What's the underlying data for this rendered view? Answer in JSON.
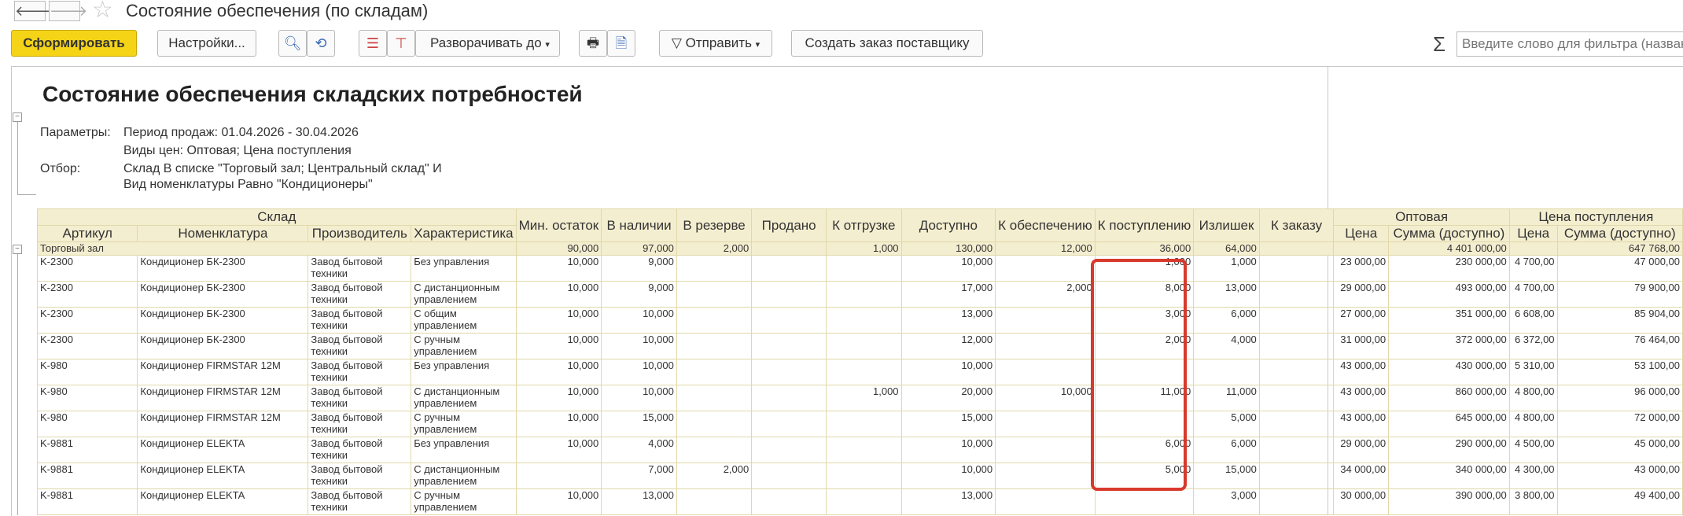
{
  "window": {
    "title": "Состояние обеспечения (по складам)"
  },
  "toolbar": {
    "generate": "Сформировать",
    "settings": "Настройки...",
    "expand": "Разворачивать до",
    "send": "Отправить",
    "create_order": "Создать заказ поставщику",
    "filter_placeholder": "Введите слово для фильтра (назван"
  },
  "report": {
    "title": "Состояние обеспечения складских потребностей",
    "params_label": "Параметры:",
    "params_line1": "Период продаж: 01.04.2026 - 30.04.2026",
    "params_line2": "Виды цен: Оптовая; Цена поступления",
    "filter_label": "Отбор:",
    "filter_line1": "Склад В списке \"Торговый зал; Центральный склад\" И",
    "filter_line2": "Вид номенклатуры Равно \"Кондиционеры\""
  },
  "headers": {
    "warehouse": "Склад",
    "article": "Артикул",
    "nomenclature": "Номенклатура",
    "manufacturer": "Производитель",
    "characteristic": "Характеристика",
    "min_stock": "Мин. остаток",
    "in_stock": "В наличии",
    "reserved": "В резерве",
    "sold": "Продано",
    "to_ship": "К отгрузке",
    "available": "Доступно",
    "to_provide": "К обеспечению",
    "to_receive": "К поступлению",
    "surplus": "Излишек",
    "to_order": "К заказу",
    "wholesale": "Оптовая",
    "receipt_price": "Цена поступления",
    "price": "Цена",
    "sum_available": "Сумма (доступно)"
  },
  "total": {
    "name": "Торговый зал",
    "min_stock": "90,000",
    "in_stock": "97,000",
    "reserved": "2,000",
    "sold": "",
    "to_ship": "1,000",
    "available": "130,000",
    "to_provide": "12,000",
    "to_receive": "36,000",
    "surplus": "64,000",
    "to_order": "",
    "w_price": "",
    "w_sum": "4 401 000,00",
    "r_price": "",
    "r_sum": "647 768,00"
  },
  "rows": [
    {
      "art": "K-2300",
      "nom": "Кондиционер БК-2300",
      "man": "Завод бытовой техники",
      "char": "Без управления",
      "min": "10,000",
      "stock": "9,000",
      "res": "",
      "sold": "",
      "ship": "",
      "avail": "10,000",
      "prov": "",
      "recv": "1,000",
      "surp": "1,000",
      "ord": "",
      "wp": "23 000,00",
      "ws": "230 000,00",
      "rp": "4 700,00",
      "rs": "47 000,00"
    },
    {
      "art": "K-2300",
      "nom": "Кондиционер БК-2300",
      "man": "Завод бытовой техники",
      "char": "С дистанционным управлением",
      "min": "10,000",
      "stock": "9,000",
      "res": "",
      "sold": "",
      "ship": "",
      "avail": "17,000",
      "prov": "2,000",
      "recv": "8,000",
      "surp": "13,000",
      "ord": "",
      "wp": "29 000,00",
      "ws": "493 000,00",
      "rp": "4 700,00",
      "rs": "79 900,00"
    },
    {
      "art": "K-2300",
      "nom": "Кондиционер БК-2300",
      "man": "Завод бытовой техники",
      "char": "С общим управлением",
      "min": "10,000",
      "stock": "10,000",
      "res": "",
      "sold": "",
      "ship": "",
      "avail": "13,000",
      "prov": "",
      "recv": "3,000",
      "surp": "6,000",
      "ord": "",
      "wp": "27 000,00",
      "ws": "351 000,00",
      "rp": "6 608,00",
      "rs": "85 904,00"
    },
    {
      "art": "K-2300",
      "nom": "Кондиционер БК-2300",
      "man": "Завод бытовой техники",
      "char": "С ручным управлением",
      "min": "10,000",
      "stock": "10,000",
      "res": "",
      "sold": "",
      "ship": "",
      "avail": "12,000",
      "prov": "",
      "recv": "2,000",
      "surp": "4,000",
      "ord": "",
      "wp": "31 000,00",
      "ws": "372 000,00",
      "rp": "6 372,00",
      "rs": "76 464,00"
    },
    {
      "art": "K-980",
      "nom": "Кондиционер FIRMSTAR 12M",
      "man": "Завод бытовой техники",
      "char": "Без управления",
      "min": "10,000",
      "stock": "10,000",
      "res": "",
      "sold": "",
      "ship": "",
      "avail": "10,000",
      "prov": "",
      "recv": "",
      "surp": "",
      "ord": "",
      "wp": "43 000,00",
      "ws": "430 000,00",
      "rp": "5 310,00",
      "rs": "53 100,00"
    },
    {
      "art": "K-980",
      "nom": "Кондиционер FIRMSTAR 12M",
      "man": "Завод бытовой техники",
      "char": "С дистанционным управлением",
      "min": "10,000",
      "stock": "10,000",
      "res": "",
      "sold": "",
      "ship": "1,000",
      "avail": "20,000",
      "prov": "10,000",
      "recv": "11,000",
      "surp": "11,000",
      "ord": "",
      "wp": "43 000,00",
      "ws": "860 000,00",
      "rp": "4 800,00",
      "rs": "96 000,00"
    },
    {
      "art": "K-980",
      "nom": "Кондиционер FIRMSTAR 12M",
      "man": "Завод бытовой техники",
      "char": "С ручным управлением",
      "min": "10,000",
      "stock": "15,000",
      "res": "",
      "sold": "",
      "ship": "",
      "avail": "15,000",
      "prov": "",
      "recv": "",
      "surp": "5,000",
      "ord": "",
      "wp": "43 000,00",
      "ws": "645 000,00",
      "rp": "4 800,00",
      "rs": "72 000,00"
    },
    {
      "art": "K-9881",
      "nom": "Кондиционер ELEKTA",
      "man": "Завод бытовой техники",
      "char": "Без управления",
      "min": "10,000",
      "stock": "4,000",
      "res": "",
      "sold": "",
      "ship": "",
      "avail": "10,000",
      "prov": "",
      "recv": "6,000",
      "surp": "6,000",
      "ord": "",
      "wp": "29 000,00",
      "ws": "290 000,00",
      "rp": "4 500,00",
      "rs": "45 000,00"
    },
    {
      "art": "K-9881",
      "nom": "Кондиционер ELEKTA",
      "man": "Завод бытовой техники",
      "char": "С дистанционным управлением",
      "min": "",
      "stock": "7,000",
      "res": "2,000",
      "sold": "",
      "ship": "",
      "avail": "10,000",
      "prov": "",
      "recv": "5,000",
      "surp": "15,000",
      "ord": "",
      "wp": "34 000,00",
      "ws": "340 000,00",
      "rp": "4 300,00",
      "rs": "43 000,00"
    },
    {
      "art": "K-9881",
      "nom": "Кондиционер ELEKTA",
      "man": "Завод бытовой техники",
      "char": "С ручным управлением",
      "min": "10,000",
      "stock": "13,000",
      "res": "",
      "sold": "",
      "ship": "",
      "avail": "13,000",
      "prov": "",
      "recv": "",
      "surp": "3,000",
      "ord": "",
      "wp": "30 000,00",
      "ws": "390 000,00",
      "rp": "3 800,00",
      "rs": "49 400,00"
    }
  ]
}
